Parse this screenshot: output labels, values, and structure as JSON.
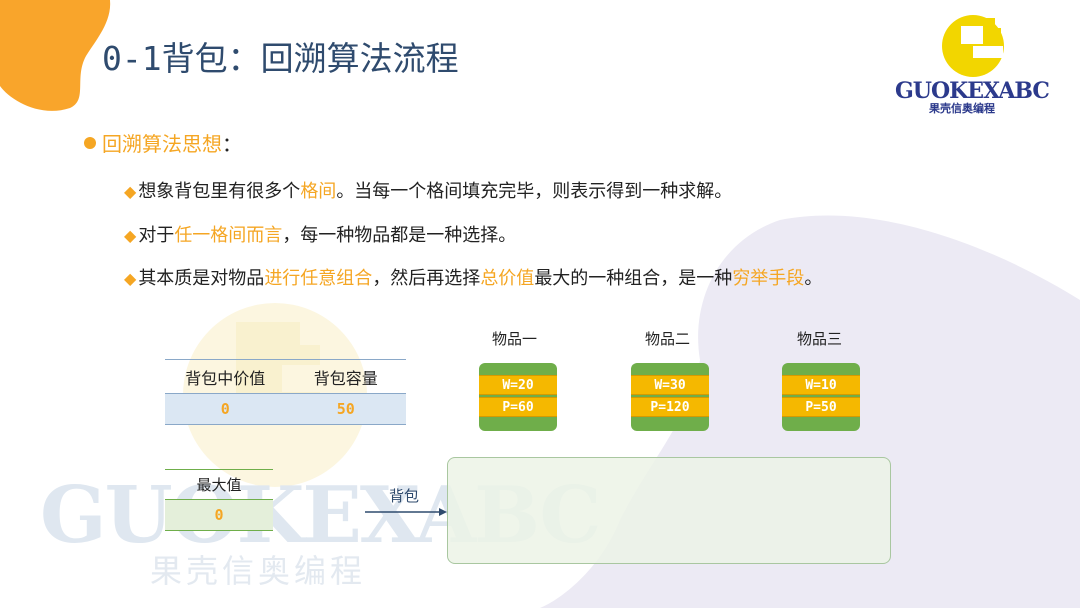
{
  "slide": {
    "title": "0-1背包：回溯算法流程"
  },
  "logo": {
    "text": "GUOKEXABC",
    "subtitle": "果壳信奥编程"
  },
  "watermark": {
    "text": "GUOKEXABC",
    "subtitle": "果壳信奥编程"
  },
  "content": {
    "main_bullet": {
      "label": "回溯算法思想",
      "suffix": "："
    },
    "points": [
      {
        "parts": [
          "想象背包里有很多个",
          "格间",
          "。当每一个格间填充完毕，则表示得到一种求解。"
        ]
      },
      {
        "parts": [
          "对于",
          "任一格间而言",
          "，每一种物品都是一种选择。"
        ]
      },
      {
        "parts": [
          "其本质是对物品",
          "进行任意组合",
          "，然后再选择",
          "总价值",
          "最大的一种组合，是一种",
          "穷举手段",
          "。"
        ]
      }
    ]
  },
  "knapsack_table": {
    "headers": [
      "背包中价值",
      "背包容量"
    ],
    "values": [
      "0",
      "50"
    ]
  },
  "max_value": {
    "label": "最大值",
    "value": "0"
  },
  "pack": {
    "label": "背包"
  },
  "items": [
    {
      "title": "物品一",
      "w": "W=20",
      "p": "P=60"
    },
    {
      "title": "物品二",
      "w": "W=30",
      "p": "P=120"
    },
    {
      "title": "物品三",
      "w": "W=10",
      "p": "P=50"
    }
  ],
  "colors": {
    "accent": "#f5a623",
    "title": "#2f4b6e",
    "item_green": "#6fae4a",
    "item_yellow": "#f5b800",
    "table_blue": "#dbe7f3"
  }
}
